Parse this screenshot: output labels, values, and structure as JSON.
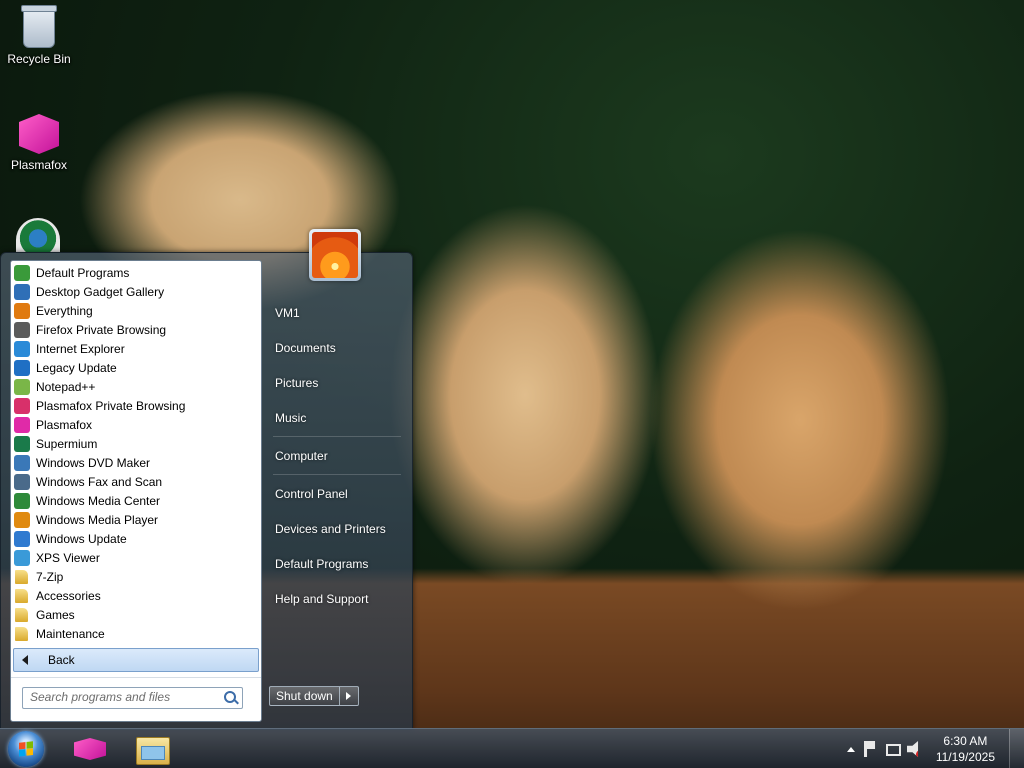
{
  "desktop": {
    "icons": [
      {
        "label": "Recycle Bin",
        "icon": "recycle-bin-icon"
      },
      {
        "label": "Plasmafox",
        "icon": "plasmafox-icon"
      },
      {
        "label": "",
        "icon": "supermium-icon"
      }
    ],
    "wallpaper": "golden retriever puppies"
  },
  "start_menu": {
    "programs": [
      {
        "label": "Default Programs",
        "icon": "default-programs-icon",
        "color": "#3a9a3a"
      },
      {
        "label": "Desktop Gadget Gallery",
        "icon": "gadget-gallery-icon",
        "color": "#2f6fb7"
      },
      {
        "label": "Everything",
        "icon": "magnifier-icon",
        "color": "#e07a10"
      },
      {
        "label": "Firefox Private Browsing",
        "icon": "private-browsing-icon",
        "color": "#5b5b5b"
      },
      {
        "label": "Internet Explorer",
        "icon": "internet-explorer-icon",
        "color": "#2a8ad8"
      },
      {
        "label": "Legacy Update",
        "icon": "legacy-update-icon",
        "color": "#1f6fc4"
      },
      {
        "label": "Notepad++",
        "icon": "notepad-plus-icon",
        "color": "#7ab648"
      },
      {
        "label": "Plasmafox Private Browsing",
        "icon": "plasmafox-private-icon",
        "color": "#d8306a"
      },
      {
        "label": "Plasmafox",
        "icon": "plasmafox-icon",
        "color": "#e02aa8"
      },
      {
        "label": "Supermium",
        "icon": "supermium-icon",
        "color": "#1a7a4a"
      },
      {
        "label": "Windows DVD Maker",
        "icon": "dvd-maker-icon",
        "color": "#3a78b8"
      },
      {
        "label": "Windows Fax and Scan",
        "icon": "fax-scan-icon",
        "color": "#4a6a8a"
      },
      {
        "label": "Windows Media Center",
        "icon": "media-center-icon",
        "color": "#2e8a3a"
      },
      {
        "label": "Windows Media Player",
        "icon": "media-player-icon",
        "color": "#e08a10"
      },
      {
        "label": "Windows Update",
        "icon": "windows-update-icon",
        "color": "#2f7ad0"
      },
      {
        "label": "XPS Viewer",
        "icon": "xps-viewer-icon",
        "color": "#3a9ad8"
      },
      {
        "label": "7-Zip",
        "icon": "folder-icon",
        "folder": true
      },
      {
        "label": "Accessories",
        "icon": "folder-icon",
        "folder": true
      },
      {
        "label": "Games",
        "icon": "folder-icon",
        "folder": true
      },
      {
        "label": "Maintenance",
        "icon": "folder-icon",
        "folder": true
      }
    ],
    "back_label": "Back",
    "search_placeholder": "Search programs and files",
    "right_items": [
      {
        "label": "VM1",
        "name": "user-folder-link"
      },
      {
        "label": "Documents",
        "name": "documents-link"
      },
      {
        "label": "Pictures",
        "name": "pictures-link"
      },
      {
        "label": "Music",
        "name": "music-link"
      },
      {
        "label": "Computer",
        "name": "computer-link"
      },
      {
        "label": "Control Panel",
        "name": "control-panel-link"
      },
      {
        "label": "Devices and Printers",
        "name": "devices-printers-link"
      },
      {
        "label": "Default Programs",
        "name": "default-programs-link"
      },
      {
        "label": "Help and Support",
        "name": "help-support-link"
      }
    ],
    "shutdown_label": "Shut down"
  },
  "taskbar": {
    "pinned": [
      {
        "name": "taskbar-plasmafox",
        "icon": "plasmafox-icon"
      },
      {
        "name": "taskbar-explorer",
        "icon": "file-explorer-icon"
      }
    ],
    "tray": {
      "icons": [
        "show-hidden-icons-arrow",
        "action-center-icon",
        "network-icon",
        "volume-muted-icon"
      ]
    },
    "clock": {
      "time": "6:30 AM",
      "date": "11/19/2025"
    }
  }
}
